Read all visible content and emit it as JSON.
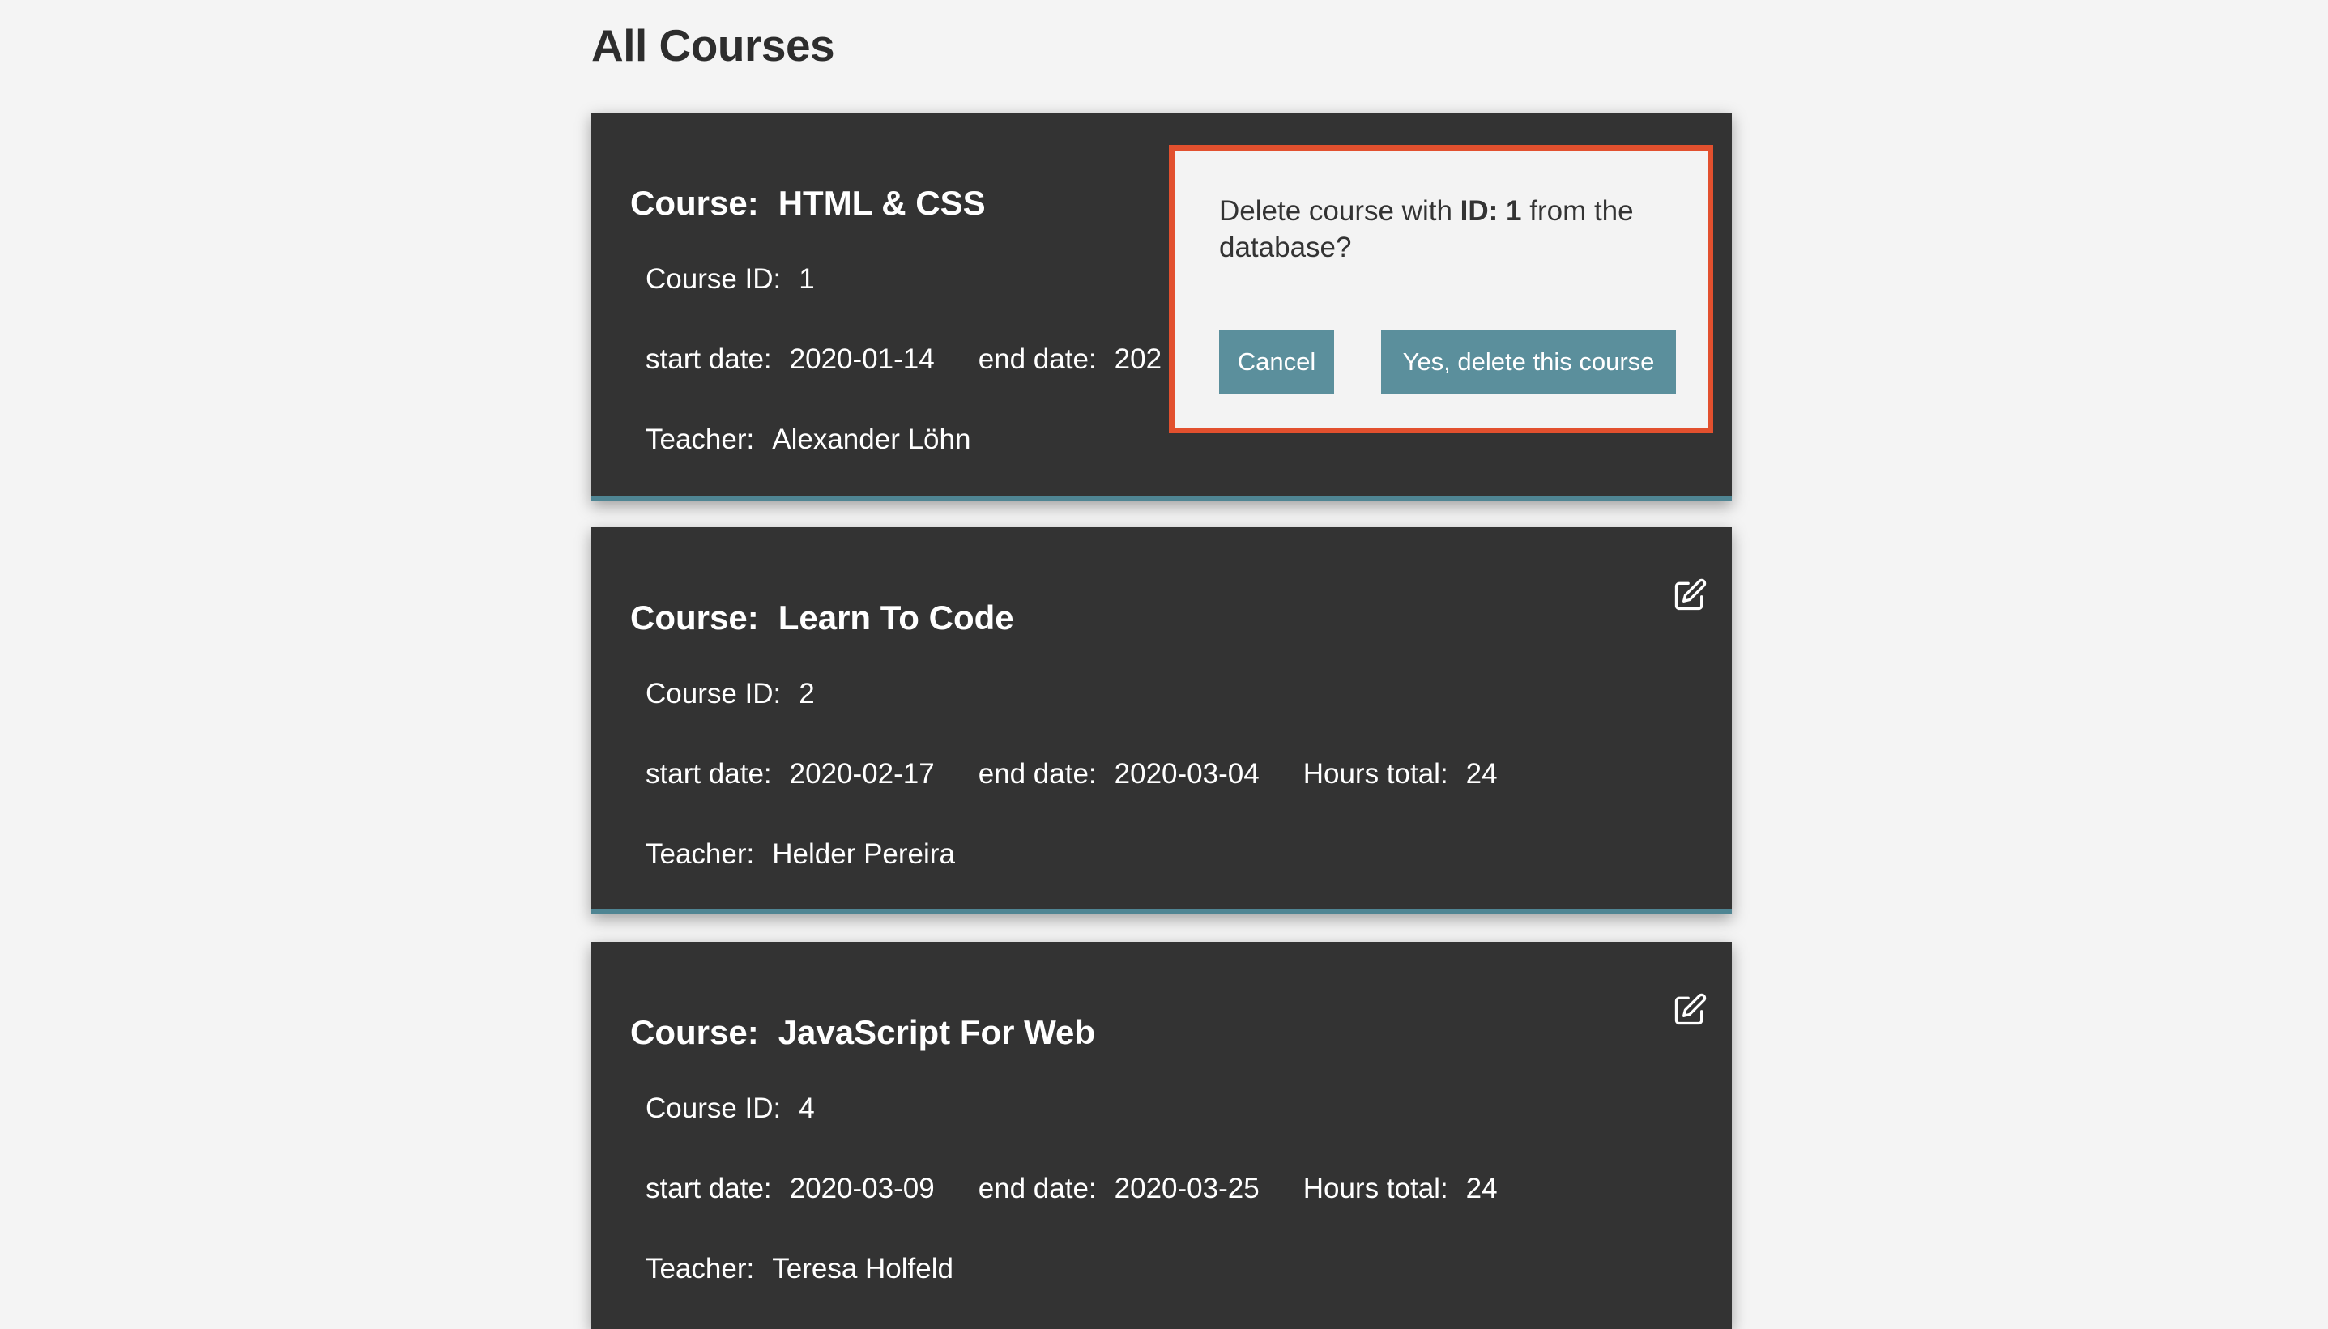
{
  "page": {
    "title": "All Courses"
  },
  "labels": {
    "course": "Course:",
    "course_id": "Course ID:",
    "start_date": "start date:",
    "end_date": "end date:",
    "hours_total": "Hours total:",
    "teacher": "Teacher:"
  },
  "courses": [
    {
      "name": "HTML & CSS",
      "id": "1",
      "start_date": "2020-01-14",
      "end_date_visible": "202",
      "teacher": "Alexander Löhn"
    },
    {
      "name": "Learn To Code",
      "id": "2",
      "start_date": "2020-02-17",
      "end_date": "2020-03-04",
      "hours_total": "24",
      "teacher": "Helder Pereira"
    },
    {
      "name": "JavaScript For Web",
      "id": "4",
      "start_date": "2020-03-09",
      "end_date": "2020-03-25",
      "hours_total": "24",
      "teacher": "Teresa Holfeld"
    }
  ],
  "dialog": {
    "message_prefix": "Delete course with ",
    "message_id": "ID: 1",
    "message_suffix": " from the database?",
    "cancel_label": "Cancel",
    "confirm_label": "Yes, delete this course"
  },
  "icons": {
    "edit": "edit-icon"
  },
  "colors": {
    "background": "#f4f4f4",
    "card": "#333333",
    "card_accent": "#4f8593",
    "dialog_border": "#e2502e",
    "dialog_bg": "#f3f3f3",
    "button": "#5b8f9c",
    "title_text": "#2d2d2d"
  }
}
